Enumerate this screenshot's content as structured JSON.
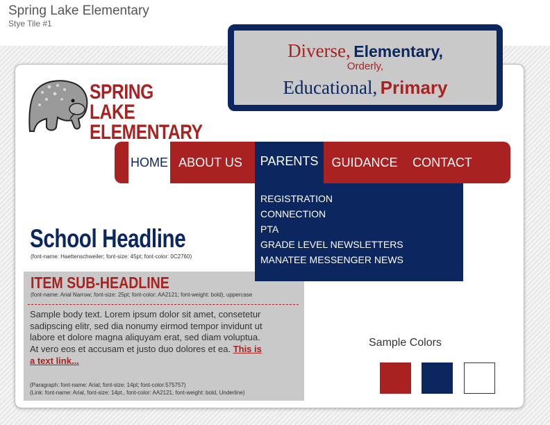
{
  "header": {
    "title": "Spring Lake Elementary",
    "subtitle": "Stye Tile #1"
  },
  "style_tile": {
    "word1": "Diverse,",
    "word2": "Elementary,",
    "word3": "Orderly,",
    "word4": "Educational,",
    "word5": "Primary"
  },
  "logo": {
    "line1": "SPRING LAKE",
    "line2": "ELEMENTARY",
    "icon": "manatee-mascot-icon"
  },
  "nav": {
    "home": "HOME",
    "about": "ABOUT US",
    "parents": "PARENTS",
    "guidance": "GUIDANCE",
    "contact": "CONTACT"
  },
  "dropdown": {
    "items": [
      "REGISTRATION",
      "CONNECTION",
      "PTA",
      "GRADE LEVEL NEWSLETTERS",
      "MANATEE MESSENGER NEWS"
    ]
  },
  "headline": {
    "text": "School Headline",
    "note": "(font-name: Haettenschweiler; font-size: 45pt; font-color: 0C2760)"
  },
  "subheadline": {
    "text": "ITEM SUB-HEADLINE",
    "note": "(font-name: Arial Narrow; font-size: 25pt; font-color: AA2121; font-weight: bold), uppercase"
  },
  "body": {
    "text": "Sample body text. Lorem ipsum dolor sit amet, consetetur sadipscing elitr, sed dia nonumy eirmod tempor invidunt ut labore et dolore magna aliquyam erat, sed diam voluptua. At vero eos et accusam et justo duo dolores et ea.",
    "link": "This is a text link...",
    "para_note": "(Paragraph: font-name: Arial; font-size: 14pt; font-color:575757)",
    "link_note": "(Link: font-name: Arial, font-size: 14pt., font-color: AA2121, font-weight: bold, Underline)"
  },
  "sample_colors": {
    "label": "Sample Colors",
    "colors": [
      "#aa2121",
      "#0c2760",
      "#ffffff"
    ]
  }
}
